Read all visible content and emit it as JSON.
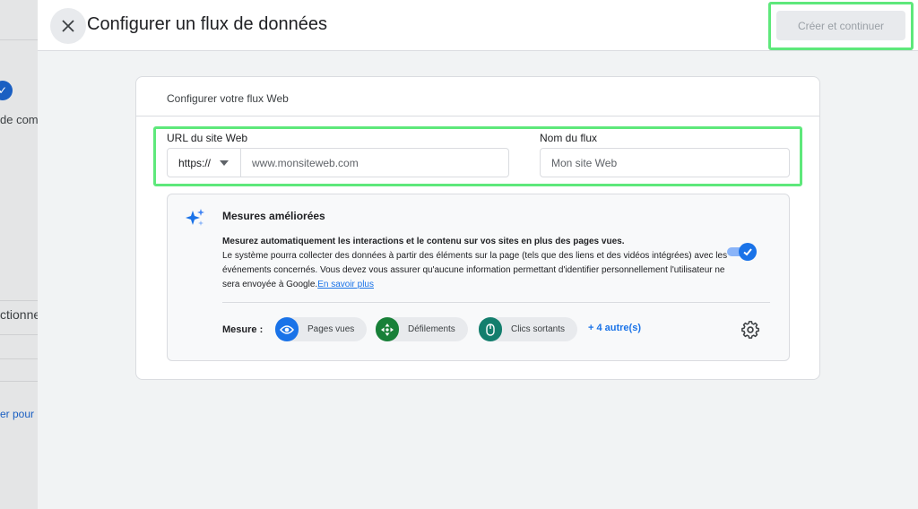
{
  "background": {
    "texts": [
      "de comp",
      "ctionne",
      "er pour"
    ]
  },
  "header": {
    "title": "Configurer un flux de données",
    "create_label": "Créer et continuer"
  },
  "card": {
    "title": "Configurer votre flux Web",
    "url_label": "URL du site Web",
    "protocol": "https://",
    "url_placeholder": "www.monsiteweb.com",
    "name_label": "Nom du flux",
    "name_placeholder": "Mon site Web"
  },
  "enhanced": {
    "title": "Mesures améliorées",
    "desc_bold": "Mesurez automatiquement les interactions et le contenu sur vos sites en plus des pages vues.",
    "desc_rest": "Le système pourra collecter des données à partir des éléments sur la page (tels que des liens et des vidéos intégrées) avec les événements concernés. Vous devez vous assurer qu'aucune information permettant d'identifier personnellement l'utilisateur ne sera envoyée à Google.",
    "learn_more": "En savoir plus",
    "toggle_on": true,
    "measure_label": "Mesure :",
    "chips": [
      {
        "label": "Pages vues",
        "icon": "eye-icon",
        "color": "#1a73e8"
      },
      {
        "label": "Défilements",
        "icon": "scroll-arrows-icon",
        "color": "#188038"
      },
      {
        "label": "Clics sortants",
        "icon": "mouse-icon",
        "color": "#137e6d"
      }
    ],
    "more": "+ 4 autre(s)"
  },
  "colors": {
    "highlight": "#5ee87b",
    "primary": "#1a73e8"
  }
}
